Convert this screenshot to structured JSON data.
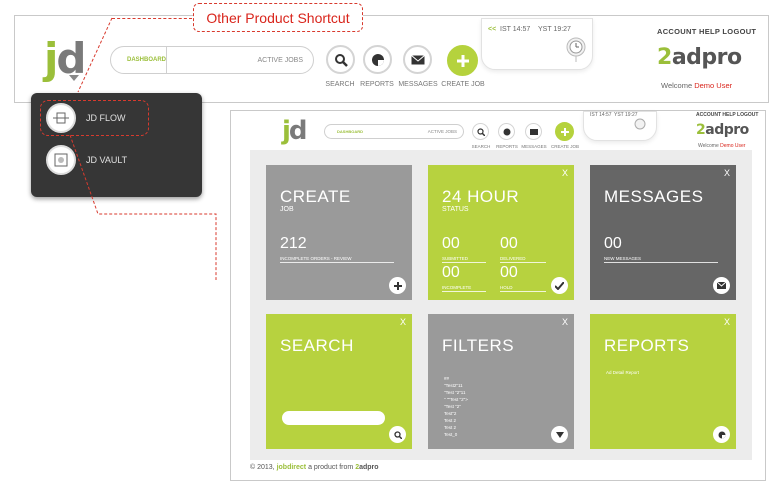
{
  "callout": {
    "label": "Other Product Shortcut"
  },
  "header": {
    "logo_j": "j",
    "logo_d": "d",
    "search_pill": {
      "label": "DASHBOARD",
      "active": "ACTIVE JOBS"
    },
    "nav": [
      {
        "label": "SEARCH",
        "icon": "search-icon"
      },
      {
        "label": "REPORTS",
        "icon": "pie-chart-icon"
      },
      {
        "label": "MESSAGES",
        "icon": "envelope-icon"
      },
      {
        "label": "CREATE JOB",
        "icon": "plus-icon"
      }
    ],
    "clock": {
      "arrow": "<<",
      "ist": "IST 14:57",
      "yst": "YST 19:27"
    },
    "top_links": "ACCOUNT HELP LOGOUT",
    "brand_two": "2",
    "brand_rest": "adpro",
    "welcome": "Welcome",
    "user": "Demo User"
  },
  "dropdown": {
    "items": [
      {
        "label": "JD FLOW",
        "icon": "flow-icon"
      },
      {
        "label": "JD VAULT",
        "icon": "vault-icon"
      }
    ]
  },
  "inner": {
    "search_pill": {
      "label": "DASHBOARD",
      "active": "ACTIVE JOBS"
    },
    "nav": [
      "SEARCH",
      "REPORTS",
      "MESSAGES",
      "CREATE JOB"
    ],
    "clock": {
      "ist": "IST 14:57",
      "yst": "YST 19:27"
    },
    "top_links": "ACCOUNT HELP LOGOUT",
    "welcome": "Welcome",
    "user": "Demo User"
  },
  "tiles": {
    "create": {
      "title": "CREATE",
      "sub": "JOB",
      "num": "212",
      "label": "Incomplete Orders - Review",
      "x": "X"
    },
    "status": {
      "title": "24 HOUR",
      "sub": "STATUS",
      "x": "X",
      "cells": [
        {
          "num": "00",
          "label": "SUBMITTED"
        },
        {
          "num": "00",
          "label": "DELIVERED"
        },
        {
          "num": "00",
          "label": "INCOMPLETE"
        },
        {
          "num": "00",
          "label": "HOLD"
        }
      ]
    },
    "messages": {
      "title": "MESSAGES",
      "num": "00",
      "label": "NEW MESSAGES",
      "x": "X"
    },
    "search": {
      "title": "SEARCH",
      "x": "X"
    },
    "filters": {
      "title": "FILTERS",
      "x": "X",
      "lines": [
        "##",
        "\"Test2\"11",
        "\"Test \"2\"11",
        "\" \"\"Test \"2\">",
        "\"Test \"2\"",
        "Test\"2",
        "Test 2",
        "Test 2",
        "Test_0"
      ]
    },
    "reports": {
      "title": "REPORTS",
      "x": "X",
      "item": "Ad Detail Report"
    }
  },
  "footer": {
    "copy": "© 2013,",
    "brand": "jobdirect",
    "tail": "a product from",
    "two": "2",
    "adpro": "adpro"
  },
  "colors": {
    "lime": "#b7d23f",
    "grey": "#9a9a9a",
    "dark": "#666666",
    "red": "#d9251c"
  }
}
